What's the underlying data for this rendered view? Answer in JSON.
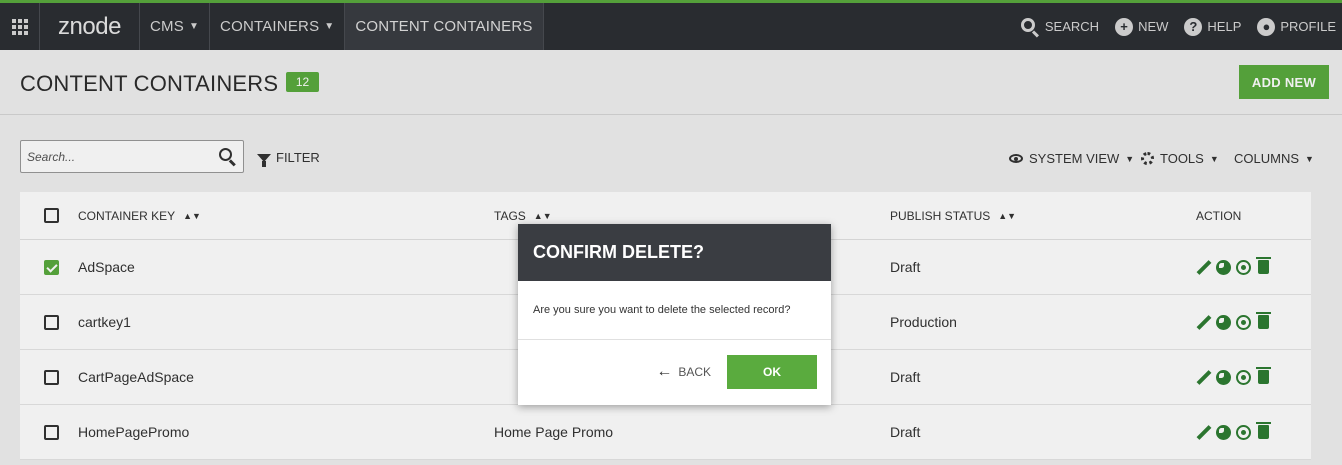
{
  "nav": {
    "logo": "znode",
    "cms": "CMS",
    "containers": "CONTAINERS",
    "active": "CONTENT CONTAINERS",
    "search": "SEARCH",
    "new": "NEW",
    "help": "HELP",
    "profile": "PROFILE",
    "accent_color": "#5aab3e"
  },
  "header": {
    "title": "CONTENT CONTAINERS",
    "count": "12",
    "add_new": "ADD NEW"
  },
  "toolbar": {
    "search_placeholder": "Search...",
    "filter": "FILTER",
    "system_view": "SYSTEM VIEW",
    "tools": "TOOLS",
    "columns": "COLUMNS"
  },
  "table": {
    "columns": [
      "CONTAINER KEY",
      "TAGS",
      "PUBLISH STATUS",
      "ACTION"
    ],
    "rows": [
      {
        "key": "AdSpace",
        "tags": "",
        "status": "Draft",
        "checked": true
      },
      {
        "key": "cartkey1",
        "tags": "",
        "status": "Production",
        "checked": false
      },
      {
        "key": "CartPageAdSpace",
        "tags": "",
        "status": "Draft",
        "checked": false
      },
      {
        "key": "HomePagePromo",
        "tags": "Home Page Promo",
        "status": "Draft",
        "checked": false
      }
    ]
  },
  "modal": {
    "title": "CONFIRM DELETE?",
    "message": "Are you sure you want to delete the selected record?",
    "back": "BACK",
    "ok": "OK"
  }
}
